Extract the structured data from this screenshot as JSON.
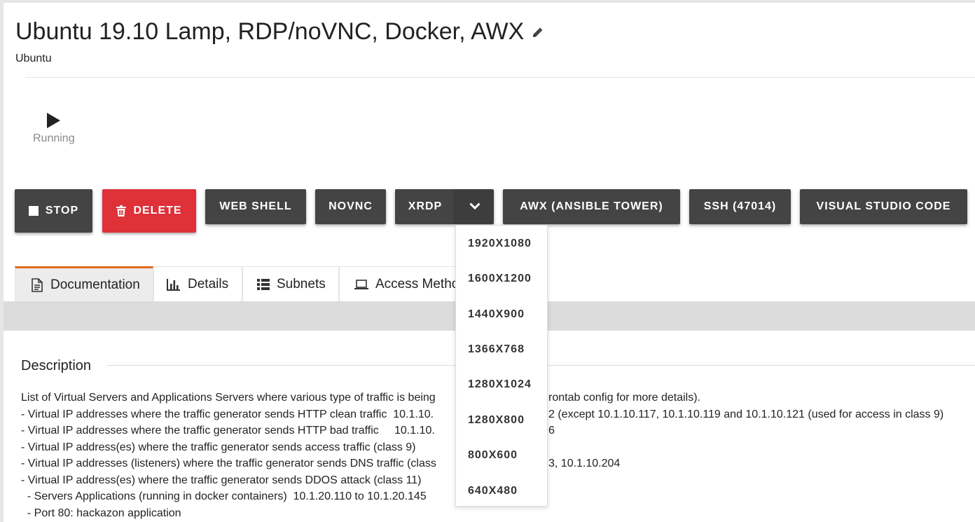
{
  "page": {
    "title": "Ubuntu 19.10 Lamp, RDP/noVNC, Docker, AWX",
    "subtitle": "Ubuntu",
    "edit_icon": "pencil-icon"
  },
  "status": {
    "icon": "play-icon",
    "label": "Running"
  },
  "actions": {
    "stop": "STOP",
    "delete": "DELETE",
    "web_shell": "WEB SHELL",
    "novnc": "NOVNC",
    "xrdp": "XRDP",
    "awx": "AWX (ANSIBLE TOWER)",
    "ssh": "SSH (47014)",
    "vscode": "VISUAL STUDIO CODE",
    "delete_color": "#de3138",
    "button_color": "#444444"
  },
  "xrdp_menu": {
    "options": [
      "1920X1080",
      "1600X1200",
      "1440X900",
      "1366X768",
      "1280X1024",
      "1280X800",
      "800X600",
      "640X480"
    ]
  },
  "tabs": [
    {
      "label": "Documentation",
      "icon": "document-icon",
      "active": true
    },
    {
      "label": "Details",
      "icon": "bar-chart-icon"
    },
    {
      "label": "Subnets",
      "icon": "list-icon"
    },
    {
      "label": "Access Metho",
      "icon": "laptop-icon"
    }
  ],
  "accent_color": "#e26b1e",
  "description": {
    "heading": "Description",
    "lines": [
      "List of Virtual Servers and Applications Servers where various type of traffic is being",
      "- Virtual IP addresses where the traffic generator sends HTTP clean traffic  10.1.10.",
      "- Virtual IP addresses where the traffic generator sends HTTP bad traffic     10.1.10.",
      "- Virtual IP address(es) where the traffic generator sends access traffic (class 9)",
      "- Virtual IP addresses (listeners) where the traffic generator sends DNS traffic (class",
      "- Virtual IP address(es) where the traffic generator sends DDOS attack (class 11)",
      "  - Servers Applications (running in docker containers)  10.1.20.110 to 10.1.20.145",
      "  - Port 80: hackazon application"
    ],
    "line_tails": [
      "rontab config for more details).",
      "2 (except 10.1.10.117, 10.1.10.119 and 10.1.10.121 (used for access in class 9)",
      "6",
      "",
      "3, 10.1.10.204",
      "",
      "",
      ""
    ]
  }
}
